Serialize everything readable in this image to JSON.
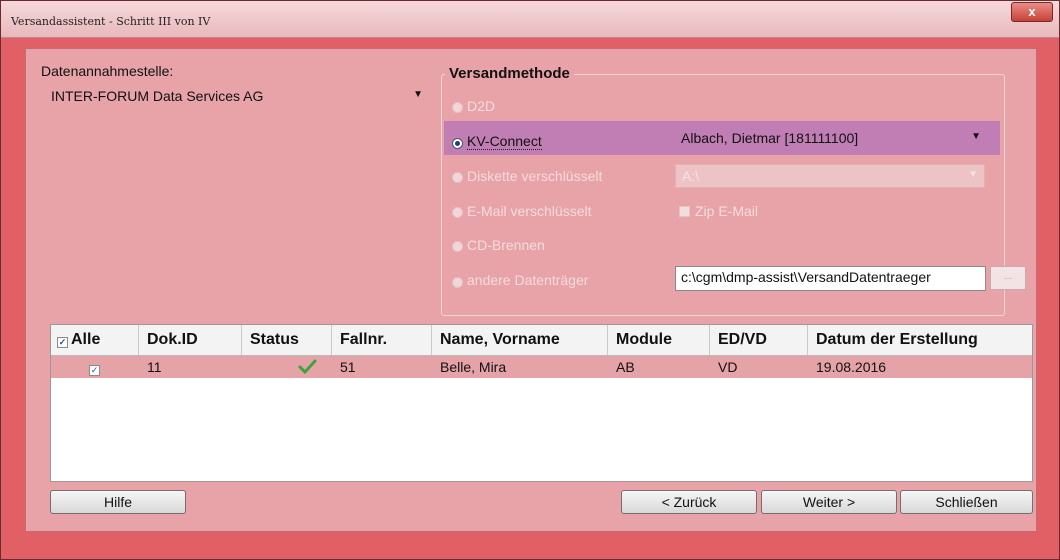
{
  "window": {
    "title": "Versandassistent - Schritt III von IV",
    "close_label": "x"
  },
  "datenannahmestelle": {
    "label": "Datenannahmestelle:",
    "selected": "INTER-FORUM Data Services AG"
  },
  "versandmethode": {
    "title": "Versandmethode",
    "options": [
      {
        "label": "D2D",
        "selected": false,
        "enabled": false
      },
      {
        "label": "KV-Connect",
        "selected": true,
        "enabled": true
      },
      {
        "label": "Diskette verschlüsselt",
        "selected": false,
        "enabled": false
      },
      {
        "label": "E-Mail verschlüsselt",
        "selected": false,
        "enabled": false
      },
      {
        "label": "CD-Brennen",
        "selected": false,
        "enabled": false
      },
      {
        "label": "andere Datenträger",
        "selected": false,
        "enabled": false
      }
    ],
    "kv_connect_user": "Albach, Dietmar [181111100]",
    "diskette_drive": "A:\\",
    "zip_email_label": "Zip E-Mail",
    "path": "c:\\cgm\\dmp-assist\\VersandDatentraeger",
    "browse_label": "..."
  },
  "table": {
    "columns": [
      "Alle",
      "Dok.ID",
      "Status",
      "Fallnr.",
      "Name, Vorname",
      "Module",
      "ED/VD",
      "Datum der Erstellung"
    ],
    "rows": [
      {
        "checked": true,
        "dok_id": "11",
        "status": "ok",
        "fallnr": "51",
        "name": "Belle, Mira",
        "module": "AB",
        "ed_vd": "VD",
        "datum": "19.08.2016"
      }
    ]
  },
  "buttons": {
    "hilfe": "Hilfe",
    "zurueck": "< Zurück",
    "weiter": "Weiter >",
    "schliessen": "Schließen"
  },
  "colors": {
    "frame": "#e06066",
    "client": "#e8a3a8",
    "highlight": "#c07eb4",
    "status_ok": "#3aa53a"
  }
}
